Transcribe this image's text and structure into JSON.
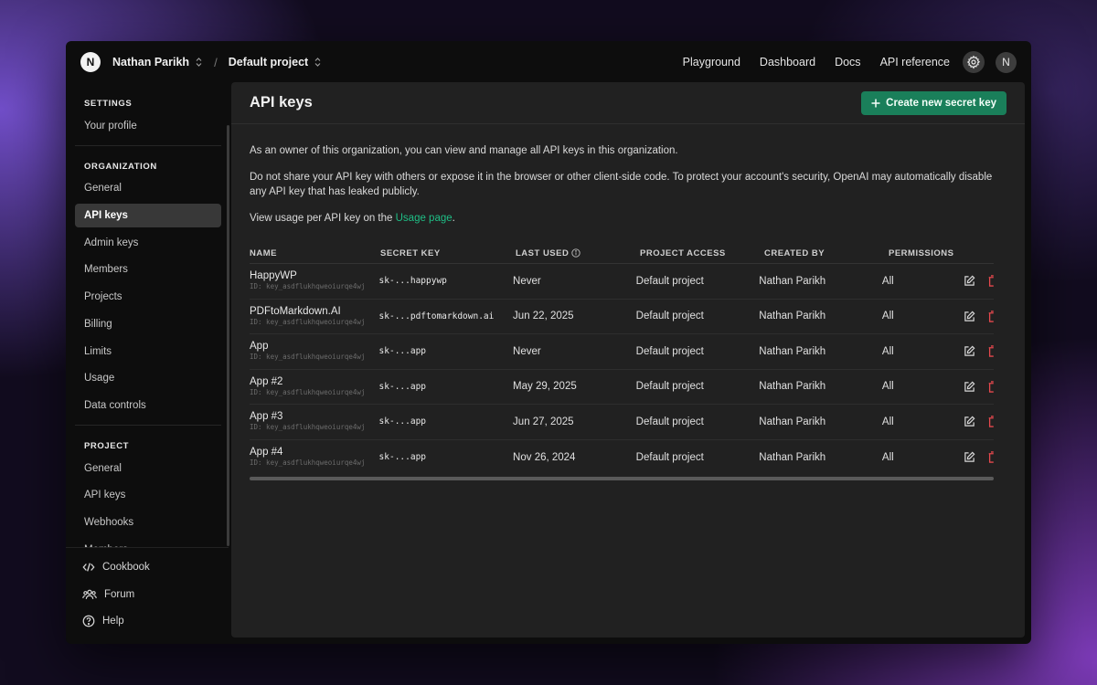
{
  "topbar": {
    "org_initial": "N",
    "org_name": "Nathan Parikh",
    "project_name": "Default project",
    "separator": "/",
    "nav": [
      "Playground",
      "Dashboard",
      "Docs",
      "API reference"
    ],
    "user_initial": "N"
  },
  "sidebar": {
    "settings_heading": "SETTINGS",
    "settings_items": [
      "Your profile"
    ],
    "organization_heading": "ORGANIZATION",
    "organization_items": [
      "General",
      "API keys",
      "Admin keys",
      "Members",
      "Projects",
      "Billing",
      "Limits",
      "Usage",
      "Data controls"
    ],
    "active_item": "API keys",
    "project_heading": "PROJECT",
    "project_items": [
      "General",
      "API keys",
      "Webhooks",
      "Members"
    ],
    "bottom": [
      {
        "label": "Cookbook",
        "icon": "code-icon"
      },
      {
        "label": "Forum",
        "icon": "users-icon"
      },
      {
        "label": "Help",
        "icon": "help-icon"
      }
    ]
  },
  "main": {
    "title": "API keys",
    "create_button": "Create new secret key",
    "intro": "As an owner of this organization, you can view and manage all API keys in this organization.",
    "warning": "Do not share your API key with others or expose it in the browser or other client-side code. To protect your account's security, OpenAI may automatically disable any API key that has leaked publicly.",
    "usage_prefix": "View usage per API key on the ",
    "usage_link": "Usage page",
    "usage_suffix": "."
  },
  "table": {
    "headers": {
      "name": "NAME",
      "secret": "SECRET KEY",
      "last_used": "LAST USED",
      "project_access": "PROJECT ACCESS",
      "created_by": "CREATED BY",
      "permissions": "PERMISSIONS"
    },
    "rows": [
      {
        "name": "HappyWP",
        "id": "ID: key_asdflukhqweoiurqe4wj",
        "secret": "sk-...happywp",
        "last_used": "Never",
        "project": "Default project",
        "created_by": "Nathan Parikh",
        "permissions": "All"
      },
      {
        "name": "PDFtoMarkdown.AI",
        "id": "ID: key_asdflukhqweoiurqe4wj",
        "secret": "sk-...pdftomarkdown.ai",
        "last_used": "Jun 22, 2025",
        "project": "Default project",
        "created_by": "Nathan Parikh",
        "permissions": "All"
      },
      {
        "name": "App",
        "id": "ID: key_asdflukhqweoiurqe4wj",
        "secret": "sk-...app",
        "last_used": "Never",
        "project": "Default project",
        "created_by": "Nathan Parikh",
        "permissions": "All"
      },
      {
        "name": "App #2",
        "id": "ID: key_asdflukhqweoiurqe4wj",
        "secret": "sk-...app",
        "last_used": "May 29, 2025",
        "project": "Default project",
        "created_by": "Nathan Parikh",
        "permissions": "All"
      },
      {
        "name": "App #3",
        "id": "ID: key_asdflukhqweoiurqe4wj",
        "secret": "sk-...app",
        "last_used": "Jun 27, 2025",
        "project": "Default project",
        "created_by": "Nathan Parikh",
        "permissions": "All"
      },
      {
        "name": "App #4",
        "id": "ID: key_asdflukhqweoiurqe4wj",
        "secret": "sk-...app",
        "last_used": "Nov 26, 2024",
        "project": "Default project",
        "created_by": "Nathan Parikh",
        "permissions": "All"
      }
    ]
  },
  "colors": {
    "accent": "#1a7f5a",
    "link": "#1fbf86",
    "delete": "#e5484d",
    "panel": "#212121",
    "sidebar": "#0d0d0d"
  }
}
